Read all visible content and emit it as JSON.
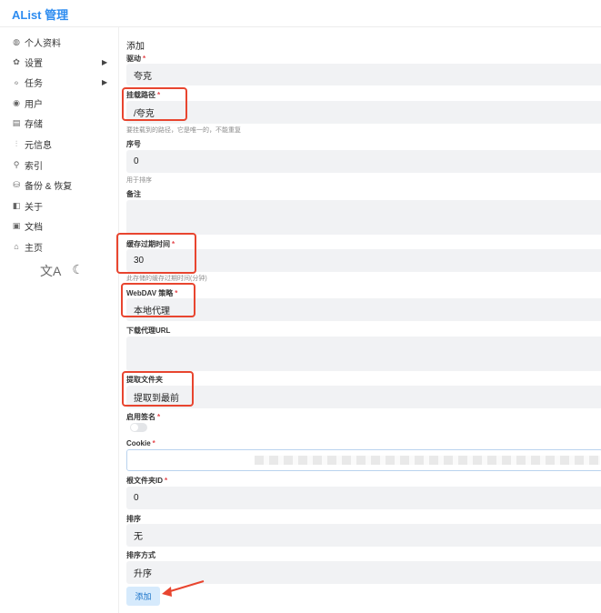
{
  "app": {
    "title": "AList 管理"
  },
  "sidebar": {
    "items": [
      {
        "label": "个人资料",
        "icon": "profile-icon"
      },
      {
        "label": "设置",
        "icon": "gear-icon"
      },
      {
        "label": "任务",
        "icon": "task-icon"
      },
      {
        "label": "用户",
        "icon": "user-icon"
      },
      {
        "label": "存储",
        "icon": "storage-icon"
      },
      {
        "label": "元信息",
        "icon": "meta-icon"
      },
      {
        "label": "索引",
        "icon": "search-icon"
      },
      {
        "label": "备份 & 恢复",
        "icon": "database-icon"
      },
      {
        "label": "关于",
        "icon": "about-icon"
      },
      {
        "label": "文档",
        "icon": "book-icon"
      },
      {
        "label": "主页",
        "icon": "home-icon"
      }
    ],
    "tools": {
      "translate": "文A",
      "theme": "☾"
    }
  },
  "form": {
    "title": "添加",
    "driver": {
      "label": "驱动",
      "value": "夸克"
    },
    "mount_path": {
      "label": "挂载路径",
      "value": "/夸克",
      "help": "要挂载到的路径，它是唯一的，不能重复"
    },
    "order": {
      "label": "序号",
      "value": "0",
      "help": "用于排序"
    },
    "remark": {
      "label": "备注",
      "value": ""
    },
    "cache_expiration": {
      "label": "缓存过期时间",
      "value": "30",
      "help": "此存储的缓存过期时间(分钟)"
    },
    "webdav_policy": {
      "label": "WebDAV 策略",
      "value": "本地代理"
    },
    "down_proxy_url": {
      "label": "下载代理URL",
      "value": ""
    },
    "extract_folder": {
      "label": "提取文件夹",
      "value": "提取到最前"
    },
    "enable_sign": {
      "label": "启用签名",
      "value": false
    },
    "cookie": {
      "label": "Cookie",
      "value": ""
    },
    "root_folder_id": {
      "label": "根文件夹ID",
      "value": "0"
    },
    "order_by": {
      "label": "排序",
      "value": "无"
    },
    "order_direction": {
      "label": "排序方式",
      "value": "升序"
    },
    "submit_label": "添加"
  },
  "colors": {
    "accent": "#2d8cf0",
    "highlight": "#e8452f",
    "required": "#e5484d"
  }
}
